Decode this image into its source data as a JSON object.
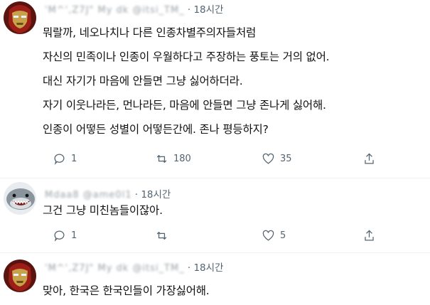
{
  "tweets": [
    {
      "handle": "'M^',Z7J\" My dk @itsi_TM_",
      "time": "· 18시간",
      "avatar": "iron-man-helmet",
      "lines": [
        "뭐랄까, 네오나치나 다른 인종차별주의자들처럼",
        "자신의 민족이나 인종이 우월하다고 주장하는 풍토는 거의 없어.",
        "대신 자기가 마음에 안들면 그냥 싫어하더라.",
        "자기 이웃나라든, 먼나라든, 마음에 안들면 그냥 존나게 싫어해.",
        "인종이 어떻든 성별이 어떻든간에. 존나 평등하지?"
      ],
      "actions": {
        "reply": "1",
        "retweet": "180",
        "like": "35",
        "share": ""
      }
    },
    {
      "handle": "Mdaa8 @ame0l1",
      "time": "· 18시간",
      "avatar": "shark-head",
      "lines": [
        "그건 그냥 미친놈들이잖아."
      ],
      "actions": {
        "reply": "1",
        "retweet": "",
        "like": "5",
        "share": ""
      }
    },
    {
      "handle": "'M^',Z7J\" My dk @itsi_TM_",
      "time": "· 18시간",
      "avatar": "iron-man-helmet",
      "lines": [
        "맞아, 한국은 한국인들이 가장싫어해."
      ],
      "actions": null
    }
  ],
  "colors": {
    "text": "#0f1419",
    "muted": "#536471",
    "divider": "#eff3f4"
  }
}
